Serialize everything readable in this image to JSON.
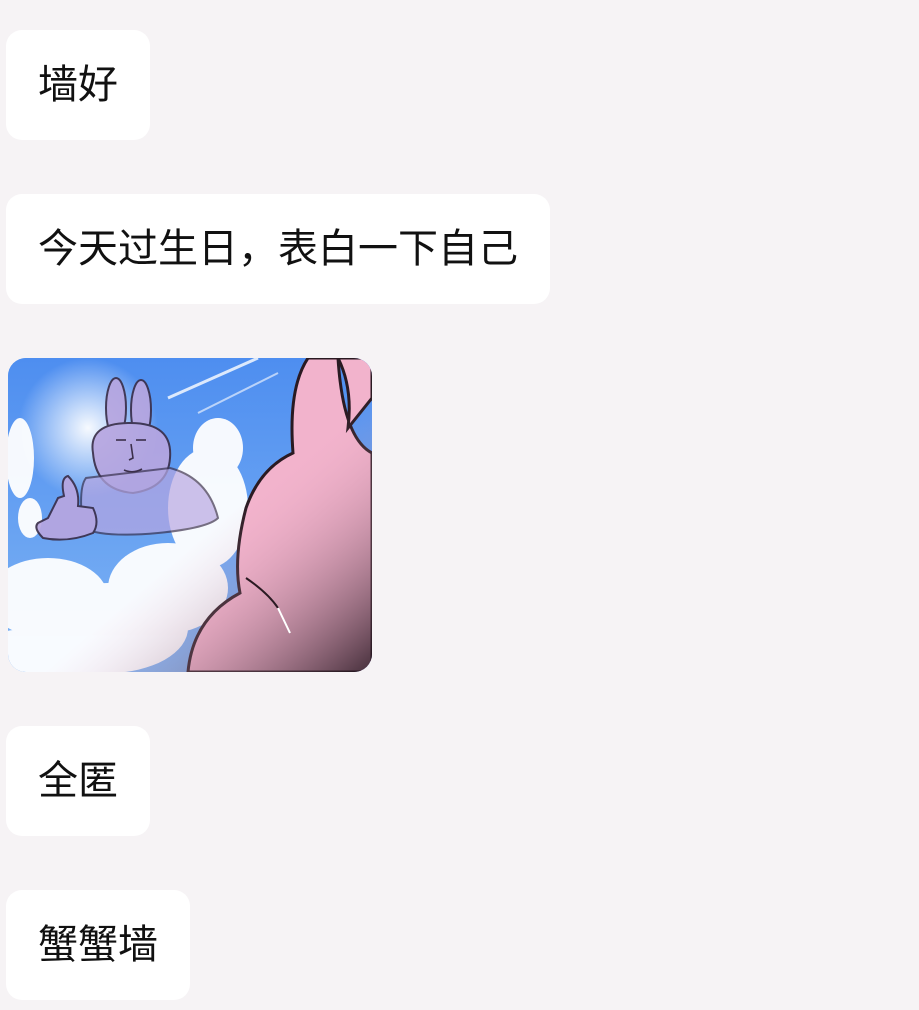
{
  "messages": [
    {
      "type": "text",
      "text": "墙好"
    },
    {
      "type": "text",
      "text": "今天过生日，表白一下自己"
    },
    {
      "type": "sticker",
      "icon": "thumbs-up-rabbit-sticker"
    },
    {
      "type": "text",
      "text": "全匿"
    },
    {
      "type": "text",
      "text": "蟹蟹墙"
    }
  ],
  "colors": {
    "background": "#f6f3f5",
    "bubble": "#ffffff",
    "text": "#111111",
    "sky": "#5f9ef0",
    "rabbit": "#f2b3cc",
    "ghost_rabbit": "#b7a6e0"
  }
}
